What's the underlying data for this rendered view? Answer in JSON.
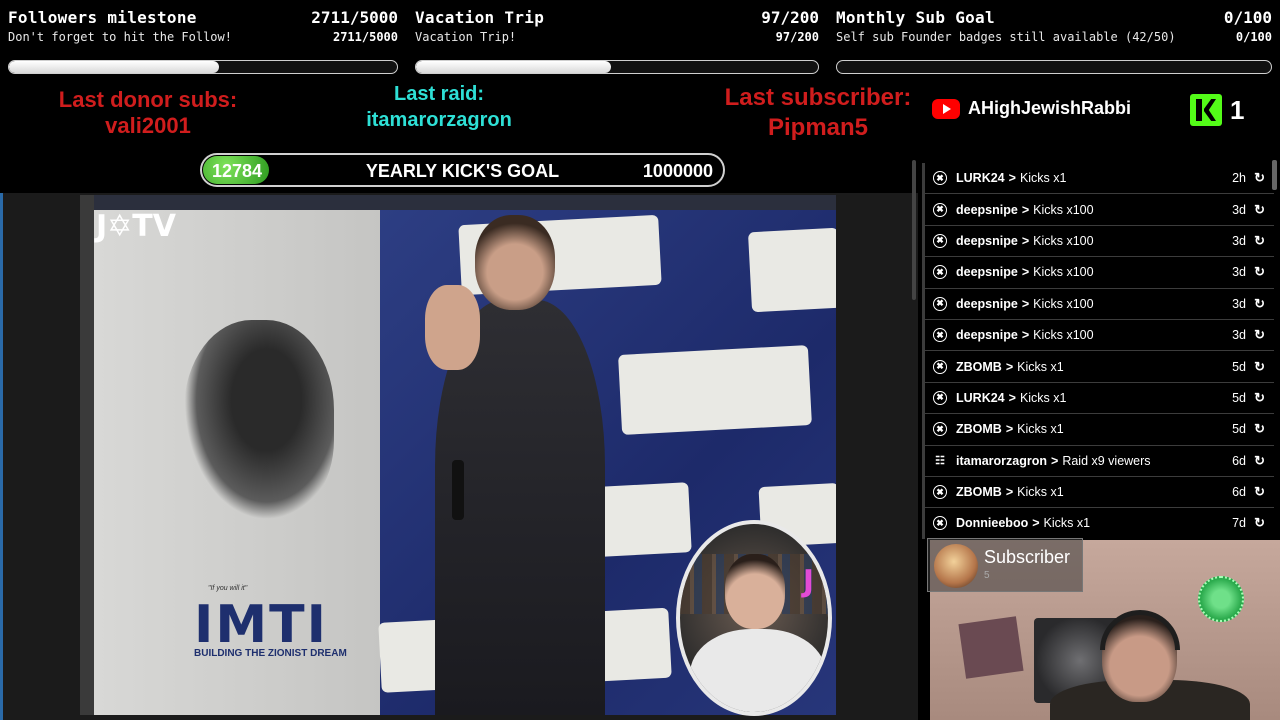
{
  "goals": [
    {
      "title": "Followers milestone",
      "count": "2711/5000",
      "subtitle": "Don't forget to hit the Follow!",
      "subcount": "2711/5000",
      "progress": 0.542
    },
    {
      "title": "Vacation Trip",
      "count": "97/200",
      "subtitle": "Vacation Trip!",
      "subcount": "97/200",
      "progress": 0.485
    },
    {
      "title": "Monthly Sub Goal",
      "count": "0/100",
      "subtitle": "Self sub Founder badges still available (42/50)",
      "subcount": "0/100",
      "progress": 0
    }
  ],
  "last_donor": {
    "label": "Last donor subs:",
    "value": "vali2001"
  },
  "last_raid": {
    "label": "Last raid:",
    "value": "itamarorzagron"
  },
  "last_subscriber": {
    "label": "Last subscriber:",
    "value": "Pipman5"
  },
  "youtube": {
    "channel": "AHighJewishRabbi",
    "icon": "youtube-icon"
  },
  "kick": {
    "count": "1",
    "icon": "kick-logo-icon"
  },
  "yearly_goal": {
    "current": "12784",
    "title": "YEARLY KICK'S GOAL",
    "target": "1000000"
  },
  "stream": {
    "watermark": "J✡TV",
    "banner_text": "IMTI",
    "banner_tagline": "BUILDING THE ZIONIST DREAM",
    "banner_quote": "\"If you will it\""
  },
  "facecam": {
    "mark": "J"
  },
  "feed": [
    {
      "user": "LURK24",
      "action": "Kicks x1",
      "time": "2h",
      "icon": "kick-circle-icon"
    },
    {
      "user": "deepsnipe",
      "action": "Kicks x100",
      "time": "3d",
      "icon": "kick-circle-icon"
    },
    {
      "user": "deepsnipe",
      "action": "Kicks x100",
      "time": "3d",
      "icon": "kick-circle-icon"
    },
    {
      "user": "deepsnipe",
      "action": "Kicks x100",
      "time": "3d",
      "icon": "kick-circle-icon"
    },
    {
      "user": "deepsnipe",
      "action": "Kicks x100",
      "time": "3d",
      "icon": "kick-circle-icon"
    },
    {
      "user": "deepsnipe",
      "action": "Kicks x100",
      "time": "3d",
      "icon": "kick-circle-icon"
    },
    {
      "user": "ZBOMB",
      "action": "Kicks x1",
      "time": "5d",
      "icon": "kick-circle-icon"
    },
    {
      "user": "LURK24",
      "action": "Kicks x1",
      "time": "5d",
      "icon": "kick-circle-icon"
    },
    {
      "user": "ZBOMB",
      "action": "Kicks x1",
      "time": "5d",
      "icon": "kick-circle-icon"
    },
    {
      "user": "itamarorzagron",
      "action": "Raid x9 viewers",
      "time": "6d",
      "icon": "raid-icon"
    },
    {
      "user": "ZBOMB",
      "action": "Kicks x1",
      "time": "6d",
      "icon": "kick-circle-icon"
    },
    {
      "user": "Donnieeboo",
      "action": "Kicks x1",
      "time": "7d",
      "icon": "kick-circle-icon"
    }
  ],
  "feed_separator": ">",
  "sub_alert": {
    "title": "Subscriber",
    "count": "5"
  },
  "colors": {
    "red": "#d01d1d",
    "cyan": "#2ee0d6",
    "kick_green": "#53fc18",
    "youtube_red": "#ff0000"
  }
}
